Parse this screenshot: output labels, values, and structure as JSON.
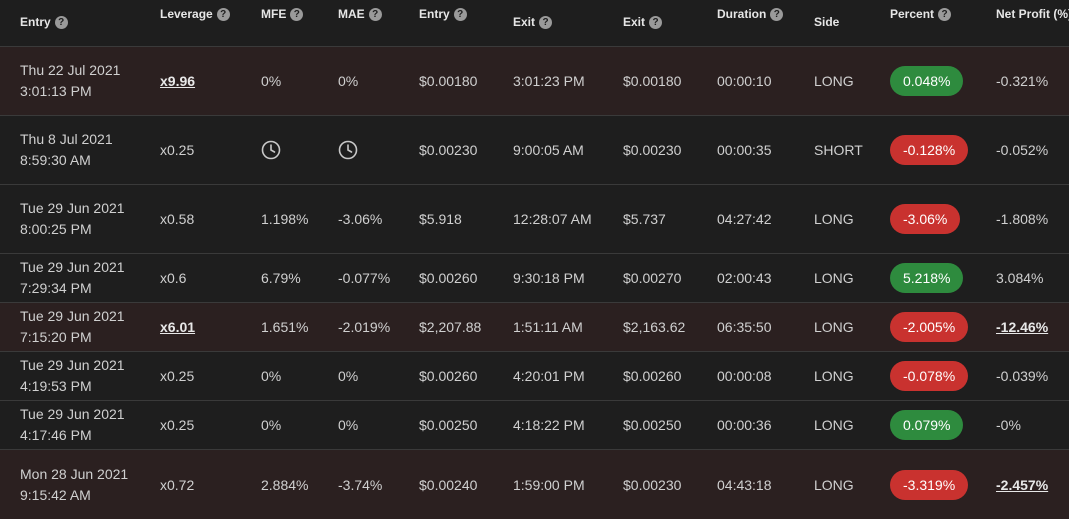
{
  "headers": {
    "entry": "Entry",
    "leverage": "Leverage",
    "mfe": "MFE",
    "mae": "MAE",
    "entry_price": "Entry",
    "exit": "Exit",
    "exit_price": "Exit",
    "duration": "Duration",
    "side": "Side",
    "percent": "Percent",
    "net_profit": "Net Profit (%)"
  },
  "help_glyph": "?",
  "rows": [
    {
      "date": "Thu 22 Jul 2021",
      "time": "3:01:13 PM",
      "leverage": "x9.96",
      "mfe": "0%",
      "mae": "0%",
      "entry_price": "$0.00180",
      "exit_time": "3:01:23 PM",
      "exit_price": "$0.00180",
      "duration": "00:00:10",
      "side": "LONG",
      "percent": "0.048%",
      "net_profit": "-0.321%"
    },
    {
      "date": "Thu 8 Jul 2021",
      "time": "8:59:30 AM",
      "leverage": "x0.25",
      "mfe": "",
      "mae": "",
      "entry_price": "$0.00230",
      "exit_time": "9:00:05 AM",
      "exit_price": "$0.00230",
      "duration": "00:00:35",
      "side": "SHORT",
      "percent": "-0.128%",
      "net_profit": "-0.052%"
    },
    {
      "date": "Tue 29 Jun 2021",
      "time": "8:00:25 PM",
      "leverage": "x0.58",
      "mfe": "1.198%",
      "mae": "-3.06%",
      "entry_price": "$5.918",
      "exit_time": "12:28:07 AM",
      "exit_price": "$5.737",
      "duration": "04:27:42",
      "side": "LONG",
      "percent": "-3.06%",
      "net_profit": "-1.808%"
    },
    {
      "date": "Tue 29 Jun 2021",
      "time": "7:29:34 PM",
      "leverage": "x0.6",
      "mfe": "6.79%",
      "mae": "-0.077%",
      "entry_price": "$0.00260",
      "exit_time": "9:30:18 PM",
      "exit_price": "$0.00270",
      "duration": "02:00:43",
      "side": "LONG",
      "percent": "5.218%",
      "net_profit": "3.084%"
    },
    {
      "date": "Tue 29 Jun 2021",
      "time": "7:15:20 PM",
      "leverage": "x6.01",
      "mfe": "1.651%",
      "mae": "-2.019%",
      "entry_price": "$2,207.88",
      "exit_time": "1:51:11 AM",
      "exit_price": "$2,163.62",
      "duration": "06:35:50",
      "side": "LONG",
      "percent": "-2.005%",
      "net_profit": "-12.46%"
    },
    {
      "date": "Tue 29 Jun 2021",
      "time": "4:19:53 PM",
      "leverage": "x0.25",
      "mfe": "0%",
      "mae": "0%",
      "entry_price": "$0.00260",
      "exit_time": "4:20:01 PM",
      "exit_price": "$0.00260",
      "duration": "00:00:08",
      "side": "LONG",
      "percent": "-0.078%",
      "net_profit": "-0.039%"
    },
    {
      "date": "Tue 29 Jun 2021",
      "time": "4:17:46 PM",
      "leverage": "x0.25",
      "mfe": "0%",
      "mae": "0%",
      "entry_price": "$0.00250",
      "exit_time": "4:18:22 PM",
      "exit_price": "$0.00250",
      "duration": "00:00:36",
      "side": "LONG",
      "percent": "0.079%",
      "net_profit": "-0%"
    },
    {
      "date": "Mon 28 Jun 2021",
      "time": "9:15:42 AM",
      "leverage": "x0.72",
      "mfe": "2.884%",
      "mae": "-3.74%",
      "entry_price": "$0.00240",
      "exit_time": "1:59:00 PM",
      "exit_price": "$0.00230",
      "duration": "04:43:18",
      "side": "LONG",
      "percent": "-3.319%",
      "net_profit": "-2.457%"
    }
  ],
  "colors": {
    "positive": "#2e8b3e",
    "negative": "#c9322f",
    "highlight_row": "#2b2020"
  }
}
